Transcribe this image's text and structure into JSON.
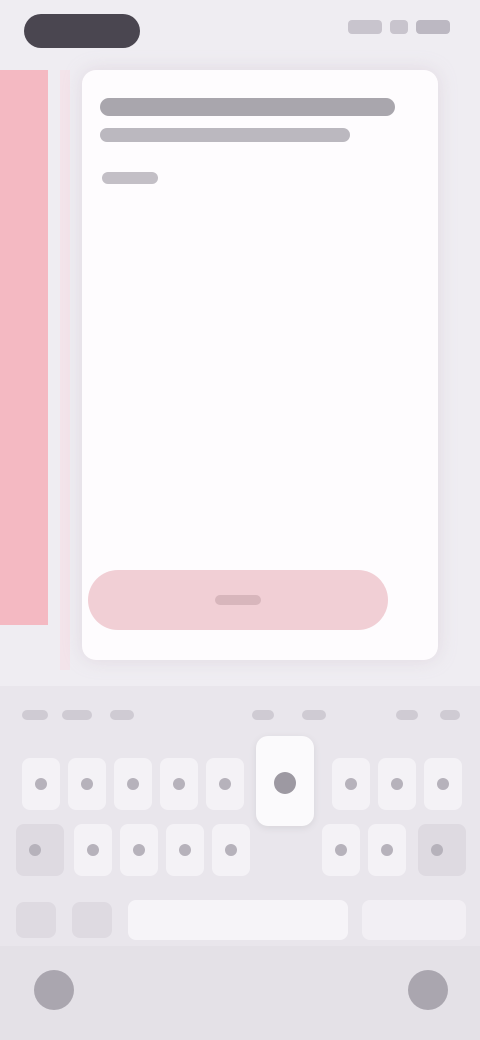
{
  "status_bar": {
    "pill": "",
    "icons": [
      "signal-icon",
      "wifi-icon",
      "battery-icon"
    ]
  },
  "card": {
    "title": "",
    "meta": "",
    "action_label": ""
  },
  "keyboard": {
    "suggestions": [
      "",
      "",
      "",
      "",
      "",
      ""
    ],
    "rows": [
      [
        "",
        "",
        "",
        "",
        "",
        "",
        "",
        "",
        "",
        ""
      ],
      [
        "",
        "",
        "",
        "",
        "",
        "",
        "",
        "",
        ""
      ],
      [
        "",
        "",
        "",
        "",
        "",
        "",
        "",
        ""
      ]
    ],
    "space_label": ""
  },
  "nav_bar": {
    "left_icon": "keyboard-hide-icon",
    "right_icon": "keyboard-switch-icon"
  },
  "colors": {
    "accent": "#f4b9c2",
    "card_button": "#f1cfd5",
    "background": "#efedf2"
  }
}
